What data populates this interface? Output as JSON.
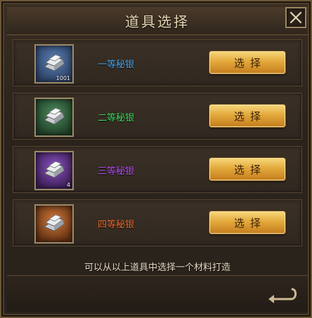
{
  "dialog": {
    "title": "道具选择",
    "hint": "可以从以上道具中选择一个材料打造"
  },
  "items": [
    {
      "name": "一等秘银",
      "name_color": "#4aa3e8",
      "count": "1001",
      "bg": "#3c5a86",
      "select_label": "选择"
    },
    {
      "name": "二等秘银",
      "name_color": "#3ed75e",
      "count": "",
      "bg": "#2f5b39",
      "select_label": "选择"
    },
    {
      "name": "三等秘银",
      "name_color": "#b04cf0",
      "count": "4",
      "bg": "#5a2f7e",
      "select_label": "选择"
    },
    {
      "name": "四等秘银",
      "name_color": "#ea6a2a",
      "count": "",
      "bg": "#8a4824",
      "select_label": "选择"
    }
  ]
}
